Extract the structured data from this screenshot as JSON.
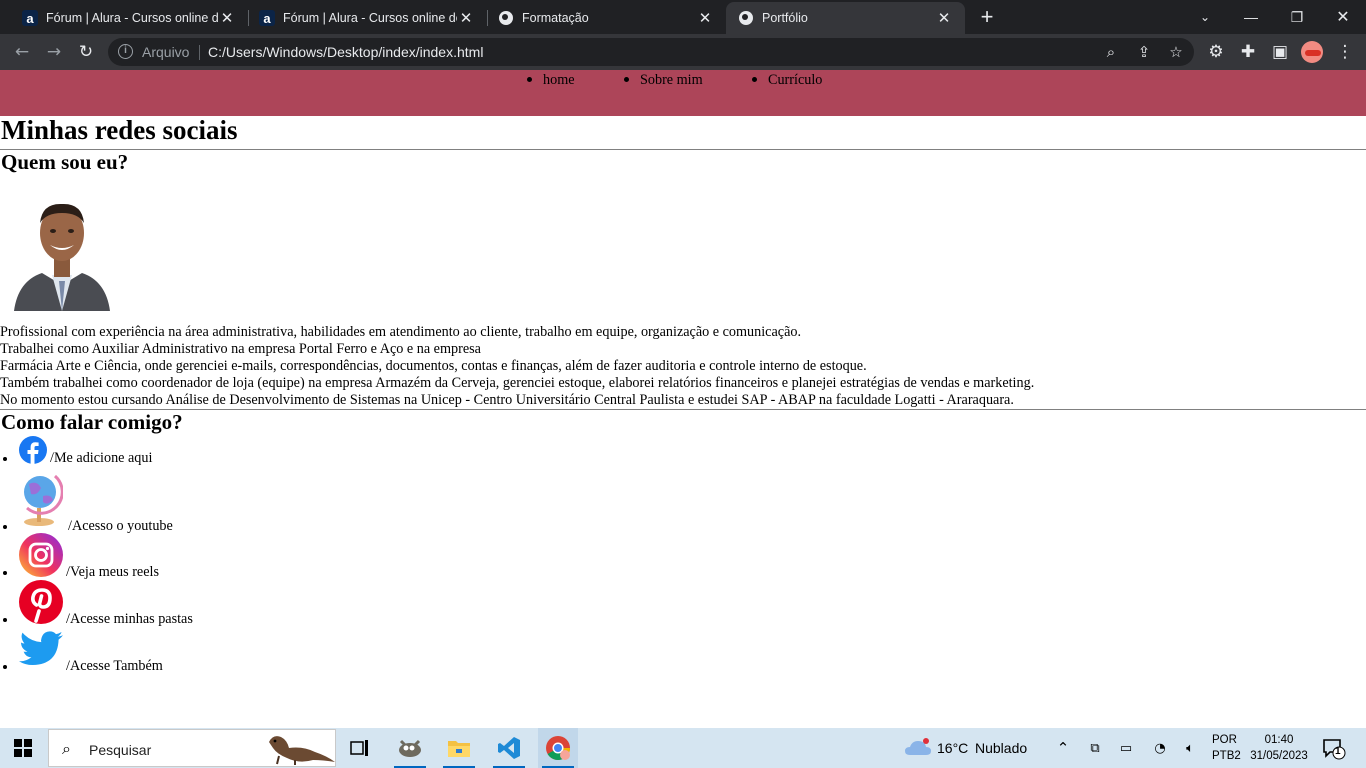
{
  "browser": {
    "tabs": [
      {
        "title": "Fórum | Alura - Cursos online de",
        "favicon": "alura-icon",
        "active": false
      },
      {
        "title": "Fórum | Alura - Cursos online de",
        "favicon": "alura-icon",
        "active": false
      },
      {
        "title": "Formatação",
        "favicon": "globe-icon",
        "active": false
      },
      {
        "title": "Portfólio",
        "favicon": "globe-icon",
        "active": true
      }
    ],
    "address": {
      "scheme_label": "Arquivo",
      "url": "C:/Users/Windows/Desktop/index/index.html"
    },
    "colors": {
      "tabbar": "#202124",
      "toolbar": "#35363a",
      "omnibox": "#202124"
    }
  },
  "page": {
    "nav": [
      "home",
      "Sobre mim",
      "Currículo"
    ],
    "header_color": "#ad4559",
    "title": "Minhas redes sociais",
    "about_heading": "Quem sou eu?",
    "bio": [
      "Profissional com experiência na área administrativa, habilidades em atendimento ao cliente, trabalho em equipe, organização e comunicação.",
      "Trabalhei como Auxiliar Administrativo na empresa Portal Ferro e Aço e na empresa",
      "Farmácia Arte e Ciência, onde gerenciei e-mails, correspondências, documentos, contas e finanças, além de fazer auditoria e controle interno de estoque.",
      "Também trabalhei como coordenador de loja (equipe) na empresa Armazém da Cerveja, gerenciei estoque, elaborei relatórios financeiros e planejei estratégias de vendas e marketing.",
      "No momento estou cursando Análise de Desenvolvimento de Sistemas na Unicep - Centro Universitário Central Paulista e estudei SAP - ABAP na faculdade Logatti - Araraquara."
    ],
    "contact_heading": "Como falar comigo?",
    "contacts": [
      {
        "icon": "facebook-icon",
        "text": "/Me adicione aqui"
      },
      {
        "icon": "globe-icon",
        "text": "/Acesso o youtube"
      },
      {
        "icon": "instagram-icon",
        "text": "/Veja meus reels"
      },
      {
        "icon": "pinterest-icon",
        "text": "/Acesse minhas pastas"
      },
      {
        "icon": "twitter-icon",
        "text": "/Acesse Também"
      }
    ]
  },
  "taskbar": {
    "search_placeholder": "Pesquisar",
    "weather": {
      "temp": "16°C",
      "condition": "Nublado"
    },
    "language": {
      "line1": "POR",
      "line2": "PTB2"
    },
    "clock": {
      "time": "01:40",
      "date": "31/05/2023"
    },
    "notification_count": "1"
  }
}
